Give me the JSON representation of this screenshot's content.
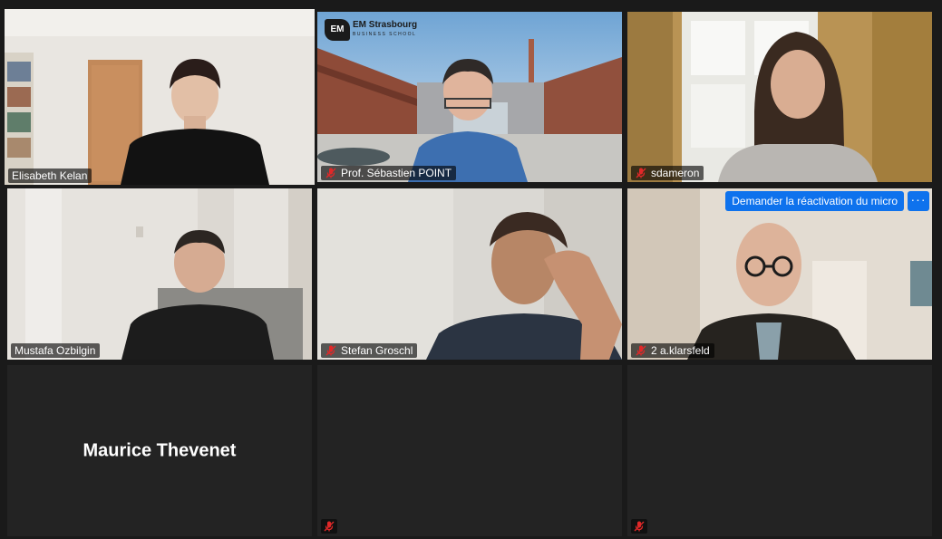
{
  "participants": [
    {
      "name": "Elisabeth Kelan",
      "muted": false,
      "active_speaker": true
    },
    {
      "name": "Prof. Sébastien POINT",
      "muted": true,
      "active_speaker": false,
      "background_logo": {
        "name": "EM Strasbourg",
        "sub": "BUSINESS SCHOOL"
      }
    },
    {
      "name": "sdameron",
      "muted": true,
      "active_speaker": false
    },
    {
      "name": "Mustafa Ozbilgin",
      "muted": false,
      "active_speaker": false
    },
    {
      "name": "Stefan Groschl",
      "muted": true,
      "active_speaker": false
    },
    {
      "name": "2 a.klarsfeld",
      "muted": true,
      "active_speaker": false,
      "unmute_request_label": "Demander la réactivation du micro",
      "more_label": "···"
    },
    {
      "name": "Maurice Thevenet",
      "muted": false,
      "video_off": true
    },
    {
      "name": "",
      "muted": true,
      "video_off": true
    },
    {
      "name": "",
      "muted": true,
      "video_off": true
    }
  ],
  "colors": {
    "active_speaker_border": "#e6ea7a",
    "mute_red": "#e02828",
    "button_blue": "#0e72ed",
    "background": "#1a1a1a"
  },
  "icons": {
    "muted": "microphone-muted-icon"
  }
}
